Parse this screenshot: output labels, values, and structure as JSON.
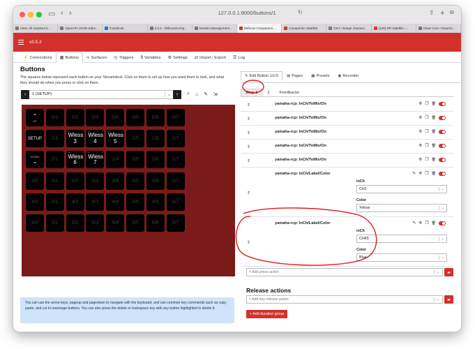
{
  "browser": {
    "url": "127.0.0.1:8000/buttons/1",
    "tabs": [
      {
        "label": "View: All snacked it..."
      },
      {
        "label": "OpenAPI JSON Edito..."
      },
      {
        "label": "Facebook"
      },
      {
        "label": "3.5.5 - bitfocus/comp..."
      },
      {
        "label": "Module Management..."
      },
      {
        "label": "Bitfocus Companion..."
      },
      {
        "label": "Companion Satellite"
      },
      {
        "label": "Dm7 change channel..."
      },
      {
        "label": "(130) RP-Satellite -..."
      },
      {
        "label": "Clear-Com • Downlo..."
      }
    ],
    "active_tab": 5,
    "colors": {
      "close": "#ff5f57",
      "min": "#febc2e",
      "max": "#28c840"
    }
  },
  "app": {
    "version": "v3.5.2",
    "accent": "#d2312b",
    "nav_tabs": [
      {
        "icon": "plug-icon",
        "glyph": "⚡",
        "label": "Connections"
      },
      {
        "icon": "grid-icon",
        "glyph": "▦",
        "label": "Buttons"
      },
      {
        "icon": "surfaces-icon",
        "glyph": "∞",
        "label": "Surfaces"
      },
      {
        "icon": "clock-icon",
        "glyph": "◷",
        "label": "Triggers"
      },
      {
        "icon": "dollar-icon",
        "glyph": "$",
        "label": "Variables"
      },
      {
        "icon": "gear-icon",
        "glyph": "⚙",
        "label": "Settings"
      },
      {
        "icon": "import-icon",
        "glyph": "⇄",
        "label": "Import / Export"
      },
      {
        "icon": "log-icon",
        "glyph": "☰",
        "label": "Log"
      }
    ],
    "active_nav": 1
  },
  "buttons_panel": {
    "title": "Buttons",
    "description": "The squares below represent each button on your Streamdeck. Click on them to set up how you want them to look, and what they should do when you press or click on them.",
    "page_select": "1 (SETUP)",
    "help_text": "You can use the arrow keys, pageup and pagedown to navigate with the keyboard, and use common key commands such as copy, paste, and cut to rearrange buttons. You can also press the delete or backspace key with any button highlighted to delete it.",
    "grid": [
      [
        "UP",
        "0/1",
        "0/2",
        "0/3",
        "0/4",
        "0/5",
        "0/6",
        "0/7"
      ],
      [
        "SETUP",
        "1/1",
        "Wless 3",
        "Wless 4",
        "Wless 5",
        "1/5",
        "1/6",
        "1/7"
      ],
      [
        "DOWN",
        "2/1",
        "Wless 6",
        "Wless 7",
        "2/4",
        "2/5",
        "2/6",
        "2/7"
      ],
      [
        "3/0",
        "3/1",
        "3/2",
        "3/3",
        "3/4",
        "3/5",
        "3/6",
        "3/7"
      ],
      [
        "4/0",
        "4/1",
        "4/2",
        "4/3",
        "4/4",
        "4/5",
        "4/6",
        "4/7"
      ],
      [
        "5/0",
        "5/1",
        "5/2",
        "5/3",
        "5/4",
        "5/5",
        "5/6",
        "5/7"
      ]
    ]
  },
  "editor": {
    "tabs": [
      {
        "icon": "edit-icon",
        "glyph": "✎",
        "label": "Edit Button 1/1/2"
      },
      {
        "icon": "pages-icon",
        "glyph": "▤",
        "label": "Pages"
      },
      {
        "icon": "presets-icon",
        "glyph": "▦",
        "label": "Presets"
      },
      {
        "icon": "recorder-icon",
        "glyph": "◉",
        "label": "Recorder"
      }
    ],
    "steps": [
      "Step 1",
      "2",
      "Feedbacks"
    ],
    "actions": [
      {
        "name": "yamaha-rcp: InCh/ToMix/On"
      },
      {
        "name": "yamaha-rcp: InCh/ToMix/On"
      },
      {
        "name": "yamaha-rcp: InCh/ToMix/On"
      },
      {
        "name": "yamaha-rcp: InCh/ToMix/On"
      },
      {
        "name": "yamaha-rcp: InCh/ToMix/On"
      },
      {
        "name": "yamaha-rcp: InCh/Label/Color",
        "opt1_label": "inCh",
        "opt1_value": "CH1",
        "opt2_label": "Color",
        "opt2_value": "Yellow"
      },
      {
        "name": "yamaha-rcp: InCh/Label/Color",
        "opt1_label": "inCh",
        "opt1_value": "CH65",
        "opt2_label": "Color",
        "opt2_value": "Blue"
      }
    ],
    "add_press_placeholder": "+ Add press action",
    "release_title": "Release actions",
    "add_release_placeholder": "+ Add key release action",
    "add_duration_label": "+ Add duration group"
  }
}
